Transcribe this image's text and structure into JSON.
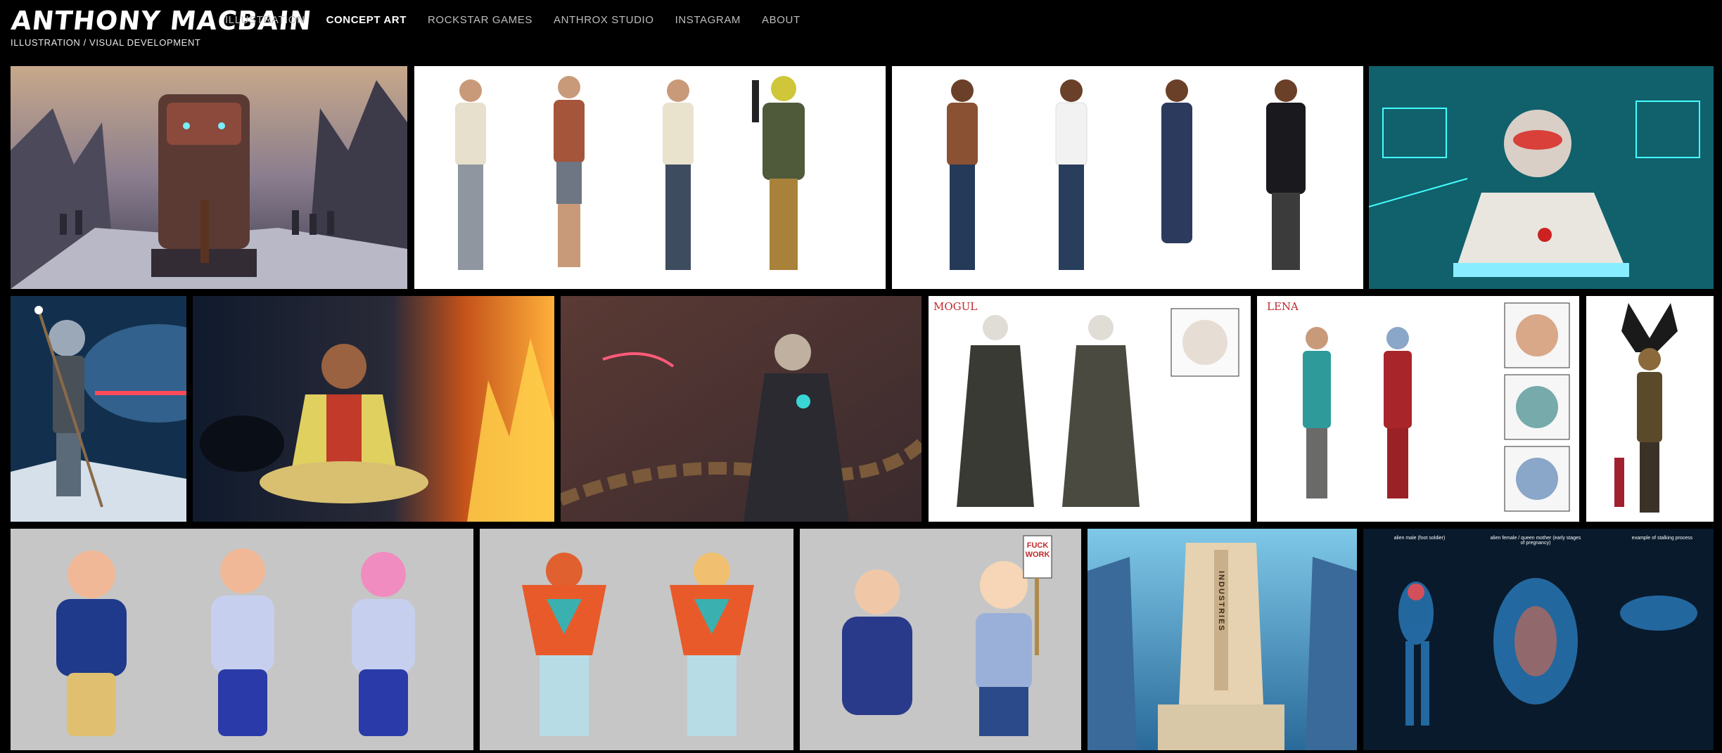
{
  "site": {
    "title": "ANTHONY MACBAIN",
    "tagline": "ILLUSTRATION / VISUAL DEVELOPMENT"
  },
  "nav": [
    {
      "label": "ILLUSTRATION",
      "active": false
    },
    {
      "label": "CONCEPT ART",
      "active": true
    },
    {
      "label": "ROCKSTAR GAMES",
      "active": false
    },
    {
      "label": "ANTHROX STUDIO",
      "active": false
    },
    {
      "label": "INSTAGRAM",
      "active": false
    },
    {
      "label": "ABOUT",
      "active": false
    }
  ],
  "gallery": {
    "mogul_label": "MOGUL",
    "lena_label": "LENA",
    "industries_sign": "INDUSTRIES",
    "protest_sign": "FUCK WORK",
    "alien_captions": [
      "alien male (foot soldier)",
      "alien female / queen mother (early stages of pregnancy)",
      "example of stalking process"
    ]
  }
}
